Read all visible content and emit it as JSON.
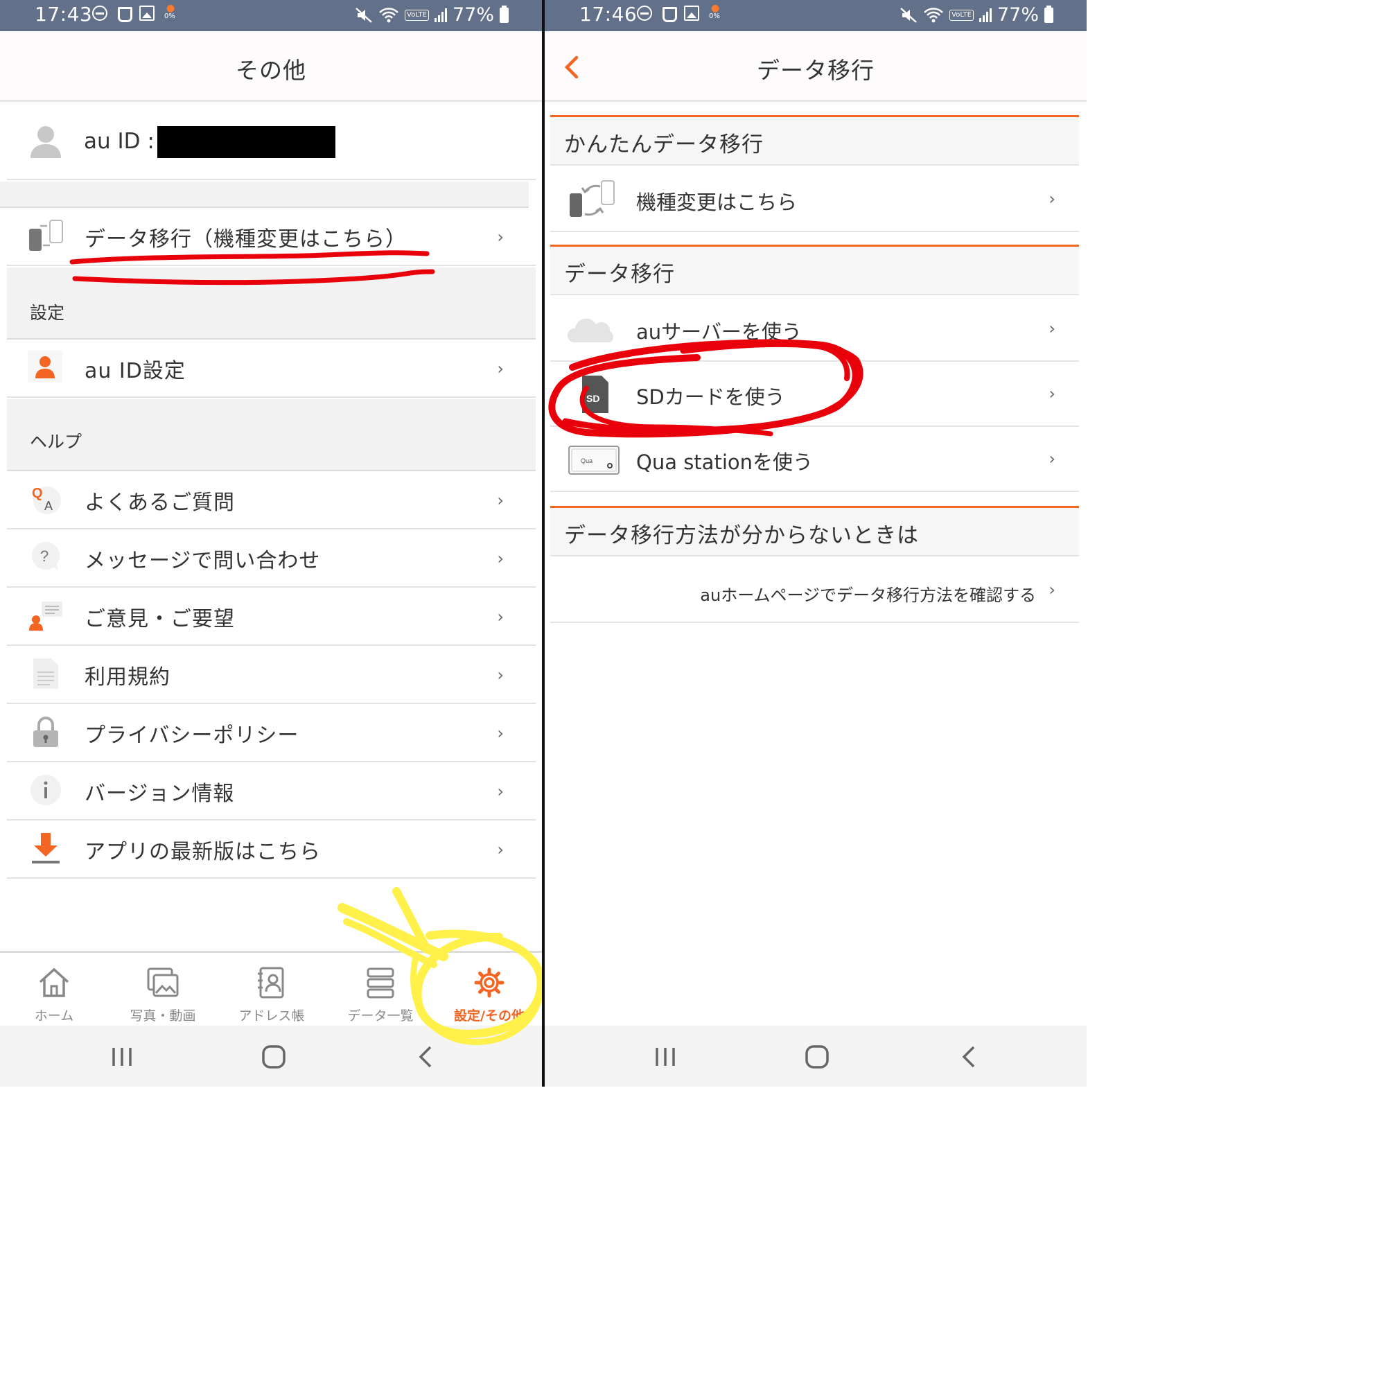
{
  "left": {
    "status": {
      "time": "17:43",
      "battery_saver": "0%",
      "battery": "77%",
      "volte": "VoLTE"
    },
    "header_title": "その他",
    "account": {
      "label": "au ID :"
    },
    "data_transfer": {
      "label": "データ移行（機種変更はこちら）"
    },
    "settings_section": {
      "title": "設定",
      "items": [
        {
          "label": "au ID設定"
        }
      ]
    },
    "help_section": {
      "title": "ヘルプ",
      "items": [
        {
          "label": "よくあるご質問",
          "icon": "qa-icon"
        },
        {
          "label": "メッセージで問い合わせ",
          "icon": "question-bubble-icon"
        },
        {
          "label": "ご意見・ご要望",
          "icon": "feedback-icon"
        },
        {
          "label": "利用規約",
          "icon": "document-icon"
        },
        {
          "label": "プライバシーポリシー",
          "icon": "lock-icon"
        },
        {
          "label": "バージョン情報",
          "icon": "info-icon"
        },
        {
          "label": "アプリの最新版はこちら",
          "icon": "download-icon"
        }
      ]
    },
    "bottom_nav": [
      {
        "label": "ホーム",
        "icon": "home-icon"
      },
      {
        "label": "写真・動画",
        "icon": "photos-icon"
      },
      {
        "label": "アドレス帳",
        "icon": "address-book-icon"
      },
      {
        "label": "データ一覧",
        "icon": "data-list-icon"
      },
      {
        "label": "設定/その他",
        "icon": "gear-icon",
        "active": true
      }
    ],
    "chevron": "›"
  },
  "right": {
    "status": {
      "time": "17:46",
      "battery_saver": "0%",
      "battery": "77%",
      "volte": "VoLTE"
    },
    "header_title": "データ移行",
    "easy_section": {
      "title": "かんたんデータ移行",
      "items": [
        {
          "label": "機種変更はこちら"
        }
      ]
    },
    "transfer_section": {
      "title": "データ移行",
      "items": [
        {
          "label": "auサーバーを使う",
          "icon": "cloud-icon"
        },
        {
          "label": "SDカードを使う",
          "icon": "sd-card-icon",
          "icon_text": "SD"
        },
        {
          "label": "Qua stationを使う",
          "icon": "qua-station-icon",
          "icon_text": "Qua"
        }
      ]
    },
    "help_section": {
      "title": "データ移行方法が分からないときは",
      "link": "auホームページでデータ移行方法を確認する"
    },
    "chevron": "›"
  },
  "colors": {
    "accent": "#f26522",
    "status_bar": "#63708a",
    "annotation_red": "#e8000b",
    "annotation_yellow": "#fff04a"
  }
}
